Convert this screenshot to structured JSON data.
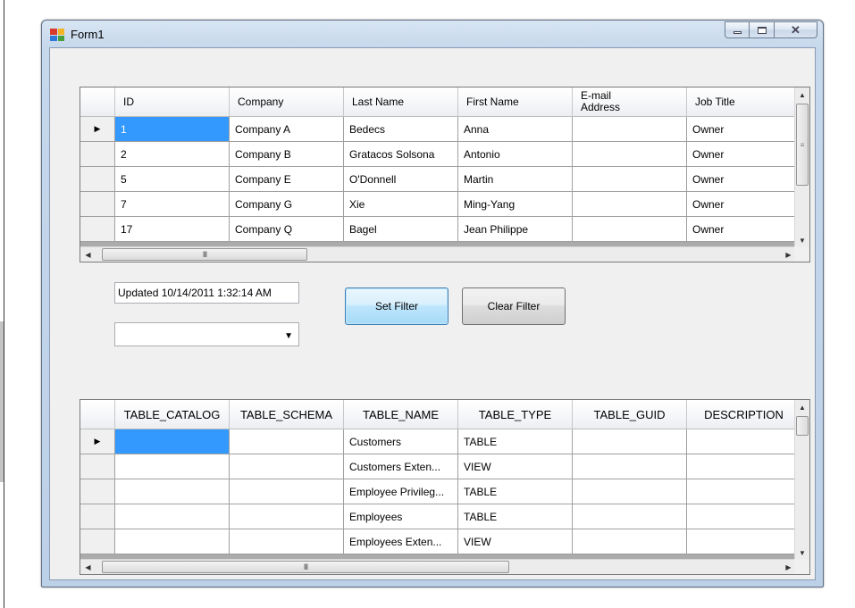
{
  "window": {
    "title": "Form1"
  },
  "grid1": {
    "columns": [
      "ID",
      "Company",
      "Last Name",
      "First Name",
      "E-mail\nAddress",
      "Job Title"
    ],
    "rows": [
      {
        "indicator": "▶",
        "cells": [
          "1",
          "Company A",
          "Bedecs",
          "Anna",
          "",
          "Owner"
        ]
      },
      {
        "indicator": "",
        "cells": [
          "2",
          "Company B",
          "Gratacos Solsona",
          "Antonio",
          "",
          "Owner"
        ]
      },
      {
        "indicator": "",
        "cells": [
          "5",
          "Company E",
          "O'Donnell",
          "Martin",
          "",
          "Owner"
        ]
      },
      {
        "indicator": "",
        "cells": [
          "7",
          "Company G",
          "Xie",
          "Ming-Yang",
          "",
          "Owner"
        ]
      },
      {
        "indicator": "",
        "cells": [
          "17",
          "Company Q",
          "Bagel",
          "Jean Philippe",
          "",
          "Owner"
        ]
      }
    ],
    "hscroll_grip": "III"
  },
  "status_text": "Updated 10/14/2011 1:32:14 AM",
  "filter_combo": {
    "value": ""
  },
  "buttons": {
    "set_filter": "Set Filter",
    "clear_filter": "Clear Filter"
  },
  "grid2": {
    "columns": [
      "TABLE_CATALOG",
      "TABLE_SCHEMA",
      "TABLE_NAME",
      "TABLE_TYPE",
      "TABLE_GUID",
      "DESCRIPTION"
    ],
    "rows": [
      {
        "indicator": "▶",
        "cells": [
          "",
          "",
          "Customers",
          "TABLE",
          "",
          ""
        ]
      },
      {
        "indicator": "",
        "cells": [
          "",
          "",
          "Customers Exten...",
          "VIEW",
          "",
          ""
        ]
      },
      {
        "indicator": "",
        "cells": [
          "",
          "",
          "Employee Privileg...",
          "TABLE",
          "",
          ""
        ]
      },
      {
        "indicator": "",
        "cells": [
          "",
          "",
          "Employees",
          "TABLE",
          "",
          ""
        ]
      },
      {
        "indicator": "",
        "cells": [
          "",
          "",
          "Employees Exten...",
          "VIEW",
          "",
          ""
        ]
      }
    ],
    "hscroll_grip": "III"
  },
  "icons": {
    "app": "form-app-icon",
    "minimize": "minimize-icon",
    "maximize": "maximize-icon",
    "close": "close-icon",
    "row_indicator": "triangle-right-icon",
    "dropdown": "chevron-down-icon",
    "scroll_up": "arrow-up-icon",
    "scroll_down": "arrow-down-icon",
    "scroll_left": "arrow-left-icon",
    "scroll_right": "arrow-right-icon"
  },
  "colors": {
    "selection": "#3399ff",
    "frame": "#bcd0e7",
    "client": "#f0f0f0",
    "grid_background": "#ababab"
  }
}
